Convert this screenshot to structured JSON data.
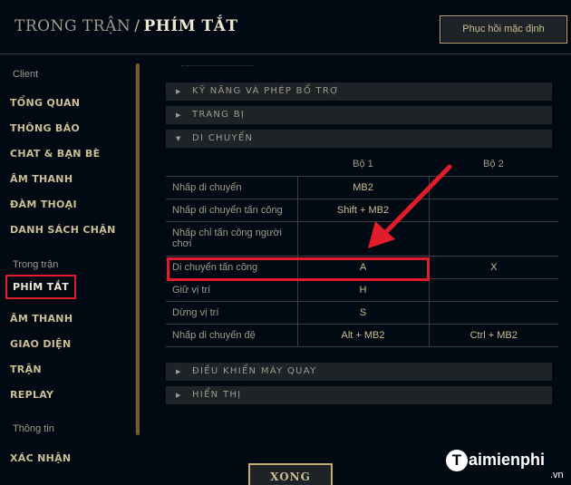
{
  "header": {
    "crumb_parent": "TRONG TRẬN",
    "crumb_sep": "/",
    "crumb_current": "PHÍM TẮT",
    "restore_button": "Phục hồi mặc định"
  },
  "sidebar": {
    "group_client": "Client",
    "client_items": [
      "TỔNG QUAN",
      "THÔNG BÁO",
      "CHAT & BẠN BÈ",
      "ÂM THANH",
      "ĐÀM THOẠI",
      "DANH SÁCH CHẶN"
    ],
    "group_ingame": "Trong trận",
    "ingame_items": [
      "PHÍM TẮT",
      "ÂM THANH",
      "GIAO DIỆN",
      "TRẬN",
      "REPLAY"
    ],
    "group_info": "Thông tin",
    "info_items": [
      "XÁC NHẬN"
    ],
    "active_item": "PHÍM TẮT"
  },
  "sections": {
    "abilities": "KỸ NĂNG VÀ PHÉP BỔ TRỢ",
    "items": "TRANG BỊ",
    "movement": "DI CHUYỂN",
    "camera": "ĐIỀU KHIỂN MÁY QUAY",
    "display": "HIỂN THỊ"
  },
  "table": {
    "headers": [
      "",
      "Bộ 1",
      "Bộ 2"
    ],
    "rows": [
      {
        "label": "Nhấp di chuyển",
        "k1": "MB2",
        "k2": ""
      },
      {
        "label": "Nhấp di chuyển tấn công",
        "k1": "Shift + MB2",
        "k2": ""
      },
      {
        "label": "Nhấp chỉ tấn công người chơi",
        "k1": "",
        "k2": ""
      },
      {
        "label": "Di chuyển tấn công",
        "k1": "A",
        "k2": "X"
      },
      {
        "label": "Giữ vị trí",
        "k1": "H",
        "k2": ""
      },
      {
        "label": "Dừng vị trí",
        "k1": "S",
        "k2": ""
      },
      {
        "label": "Nhấp di chuyển đệ",
        "k1": "Alt + MB2",
        "k2": "Ctrl + MB2"
      }
    ]
  },
  "footer": {
    "done_button": "XONG"
  },
  "watermark": {
    "logo_letter": "T",
    "brand": "aimienphi",
    "tld": ".vn"
  },
  "colors": {
    "background": "#010a13",
    "gold": "#cdbe91",
    "gold_border": "#c8aa6e",
    "highlight_red": "#e21c2a"
  },
  "icons": {
    "section_collapsed": "triangle-right-icon",
    "section_expanded": "triangle-down-icon",
    "annotation": "red-arrow-icon"
  }
}
